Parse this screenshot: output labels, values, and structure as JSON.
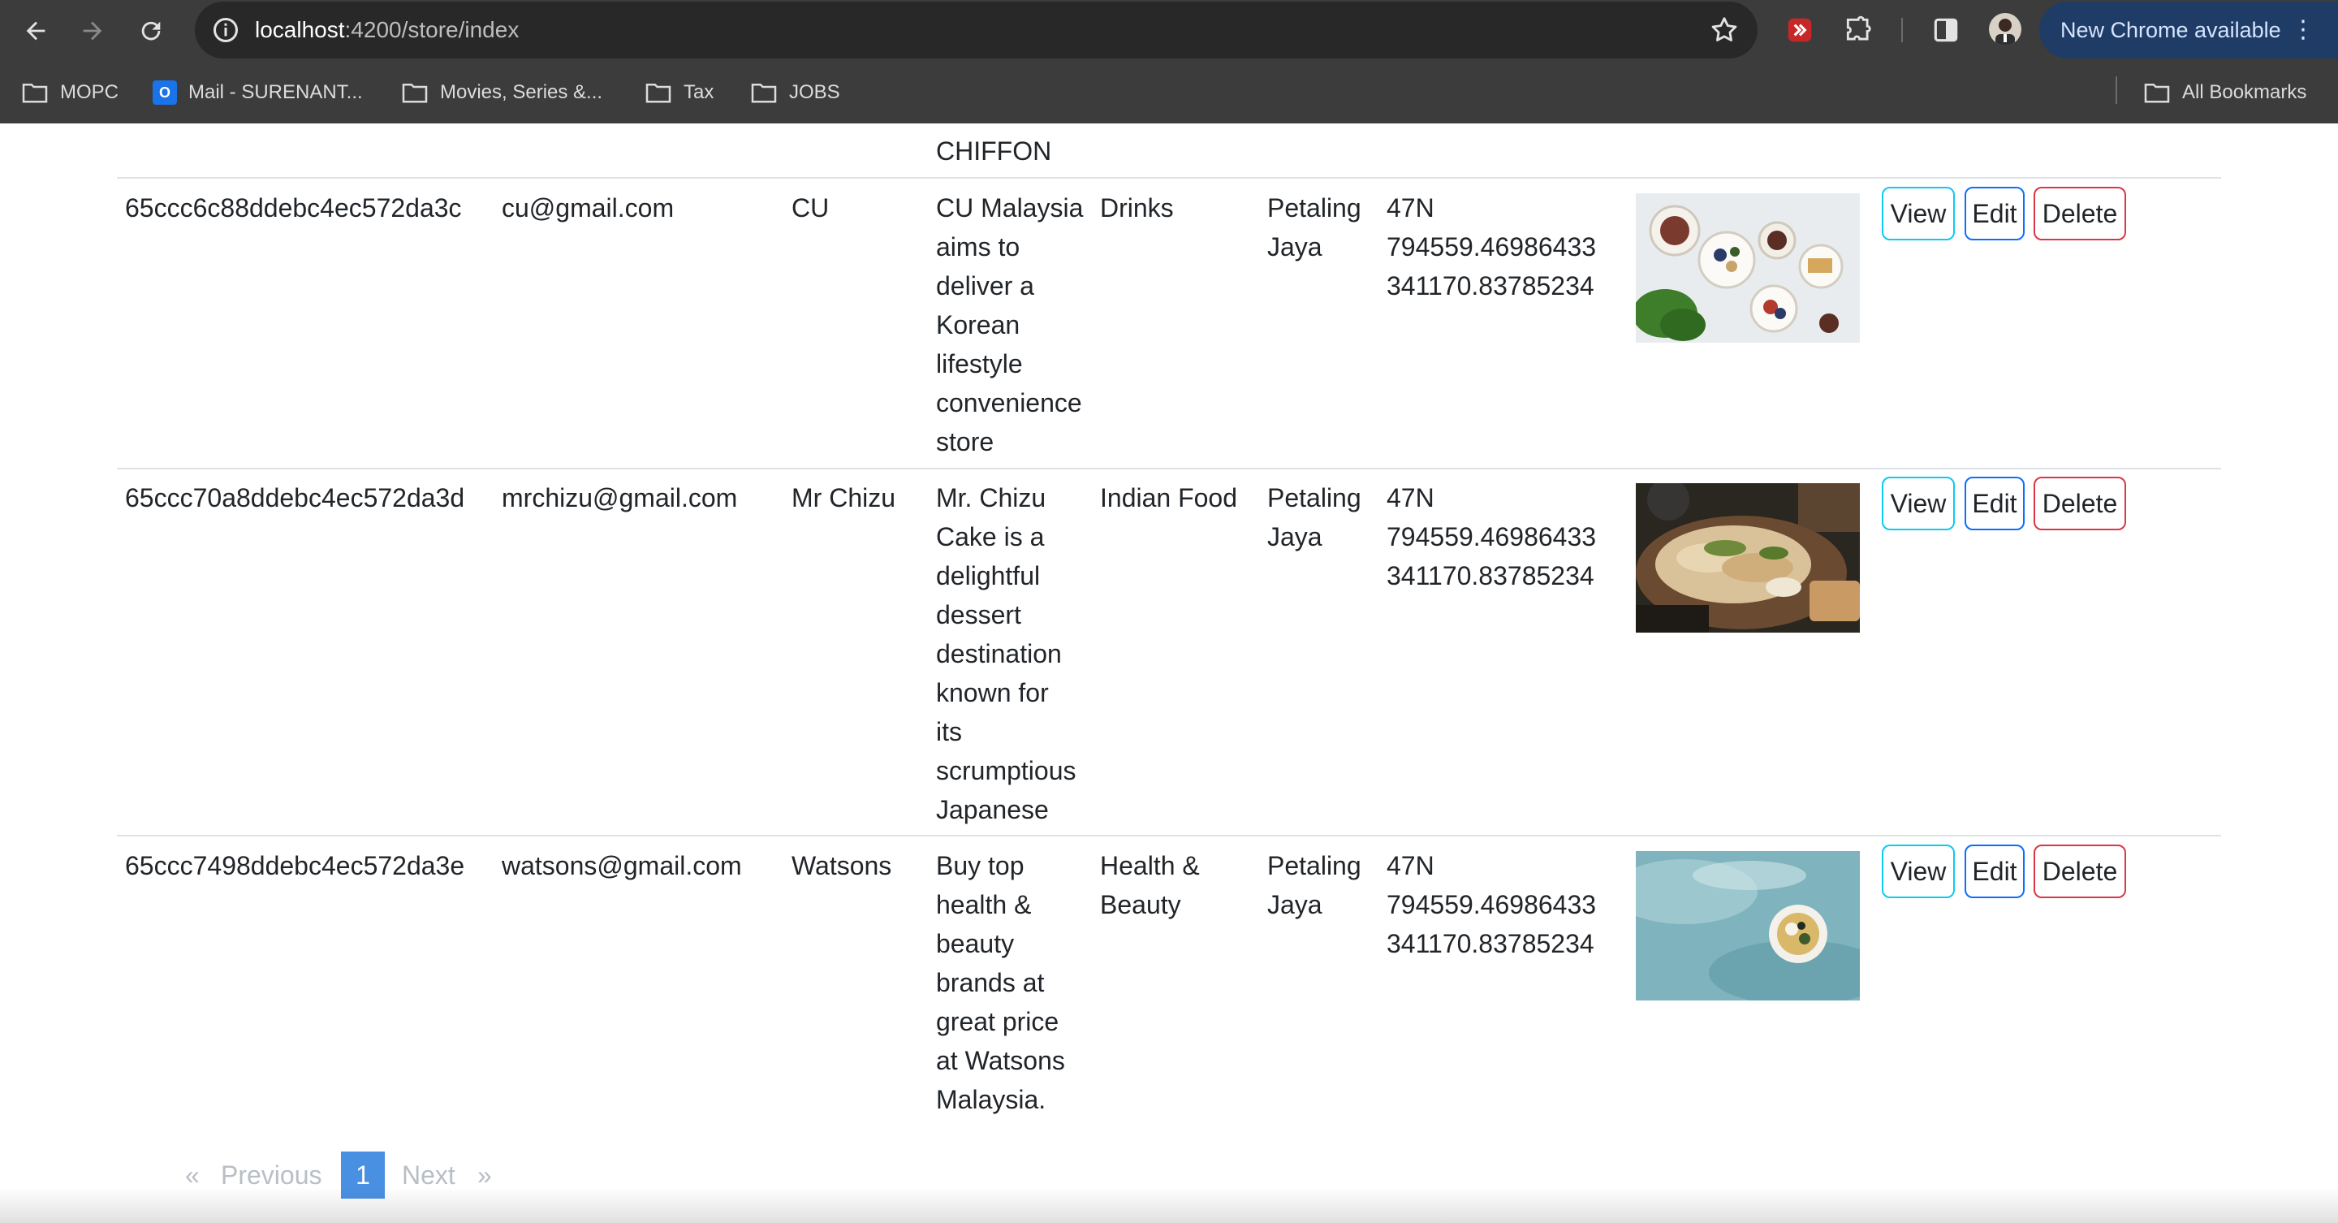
{
  "browser": {
    "url_host": "localhost",
    "url_rest": ":4200/store/index",
    "update_pill": "New Chrome available",
    "bookmarks": [
      "MOPC",
      "Mail - SURENANT...",
      "Movies, Series &...",
      "Tax",
      "JOBS"
    ],
    "all_bookmarks": "All Bookmarks"
  },
  "table": {
    "partial_row": {
      "description_tail": "CHIFFON"
    },
    "rows": [
      {
        "id": "65ccc6c88ddebc4ec572da3c",
        "email": "cu@gmail.com",
        "name": "CU",
        "description": [
          "CU Malaysia",
          "aims to",
          "deliver a",
          "Korean",
          "lifestyle",
          "convenience",
          "store"
        ],
        "category": [
          "Drinks"
        ],
        "city": [
          "Petaling",
          "Jaya"
        ],
        "location": [
          "47N",
          "794559.46986433",
          "341170.83785234"
        ],
        "image": "flatlay-breakfast"
      },
      {
        "id": "65ccc70a8ddebc4ec572da3d",
        "email": "mrchizu@gmail.com",
        "name": "Mr Chizu",
        "description": [
          "Mr. Chizu",
          "Cake is a",
          "delightful",
          "dessert",
          "destination",
          "known for",
          "its",
          "scrumptious",
          "Japanese"
        ],
        "category": [
          "Indian Food"
        ],
        "city": [
          "Petaling",
          "Jaya"
        ],
        "location": [
          "47N",
          "794559.46986433",
          "341170.83785234"
        ],
        "image": "plated-food"
      },
      {
        "id": "65ccc7498ddebc4ec572da3e",
        "email": "watsons@gmail.com",
        "name": "Watsons",
        "description": [
          "Buy top",
          "health &",
          "beauty",
          "brands at",
          "great price",
          "at Watsons",
          "Malaysia."
        ],
        "category": [
          "Health &",
          "Beauty"
        ],
        "city": [
          "Petaling",
          "Jaya"
        ],
        "location": [
          "47N",
          "794559.46986433",
          "341170.83785234"
        ],
        "image": "bowl-on-teal"
      }
    ],
    "actions": {
      "view": "View",
      "edit": "Edit",
      "delete": "Delete"
    }
  },
  "pagination": {
    "first": "«",
    "previous": "Previous",
    "current": "1",
    "next": "Next",
    "last": "»"
  },
  "colors": {
    "view": "#0dcaf0",
    "edit": "#0d6efd",
    "delete": "#dc3545",
    "page_active": "#4a90e2"
  }
}
